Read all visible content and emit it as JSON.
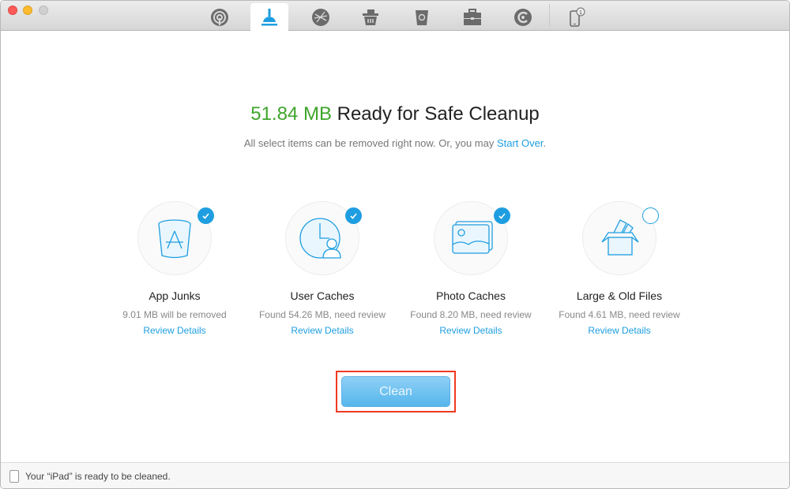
{
  "window": {
    "traffic_lights": [
      "close",
      "minimize",
      "zoom"
    ]
  },
  "toolbar": {
    "tabs": [
      {
        "name": "airbackup-icon",
        "active": false
      },
      {
        "name": "cleanup-icon",
        "active": true
      },
      {
        "name": "internet-cleanup-icon",
        "active": false
      },
      {
        "name": "privacy-cleanup-icon",
        "active": false
      },
      {
        "name": "trash-recycle-icon",
        "active": false
      },
      {
        "name": "toolkit-briefcase-icon",
        "active": false
      },
      {
        "name": "restore-icon",
        "active": false
      },
      {
        "name": "device-icon",
        "active": false,
        "badge": "1"
      }
    ],
    "accent_color": "#1e9ee0"
  },
  "main": {
    "amount": "51.84 MB",
    "headline_rest": " Ready for Safe Cleanup",
    "subtitle_text": "All select items can be removed right now. Or, you may ",
    "subtitle_link": "Start Over",
    "subtitle_end": ".",
    "amount_color": "#3fa52c",
    "categories": [
      {
        "title": "App Junks",
        "desc": "9.01 MB will be removed",
        "link": "Review Details",
        "checked": true
      },
      {
        "title": "User Caches",
        "desc": "Found 54.26 MB, need review",
        "link": "Review Details",
        "checked": true
      },
      {
        "title": "Photo Caches",
        "desc": "Found 8.20 MB, need review",
        "link": "Review Details",
        "checked": true
      },
      {
        "title": "Large & Old Files",
        "desc": "Found 4.61 MB, need review",
        "link": "Review Details",
        "checked": false
      }
    ],
    "clean_button": "Clean"
  },
  "status": {
    "text": "Your “iPad” is ready to be cleaned."
  }
}
